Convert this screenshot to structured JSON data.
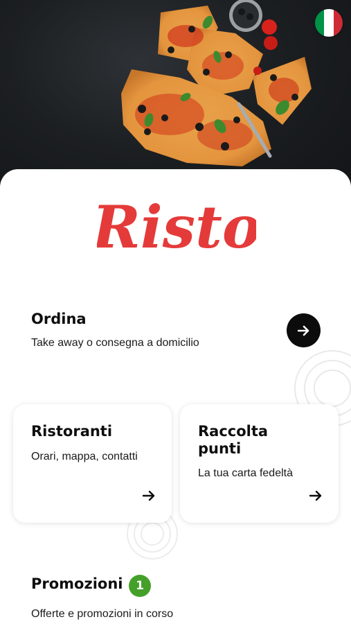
{
  "language": {
    "flag_icon": "italy-flag-icon",
    "flag_colors": [
      "#009246",
      "#ffffff",
      "#ce2b37"
    ]
  },
  "brand": {
    "logo_text": "Risto",
    "logo_color": "#e43b3a"
  },
  "ordina": {
    "title": "Ordina",
    "subtitle": "Take away o consegna a domicilio",
    "action_icon": "arrow-right-icon"
  },
  "cards": [
    {
      "title": "Ristoranti",
      "subtitle": "Orari, mappa, contatti",
      "action_icon": "arrow-right-icon"
    },
    {
      "title": "Raccolta punti",
      "subtitle": "La tua carta fedeltà",
      "action_icon": "arrow-right-icon"
    }
  ],
  "promozioni": {
    "title": "Promozioni",
    "badge_count": "1",
    "badge_color": "#44a029",
    "subtitle": "Offerte e promozioni in corso"
  }
}
